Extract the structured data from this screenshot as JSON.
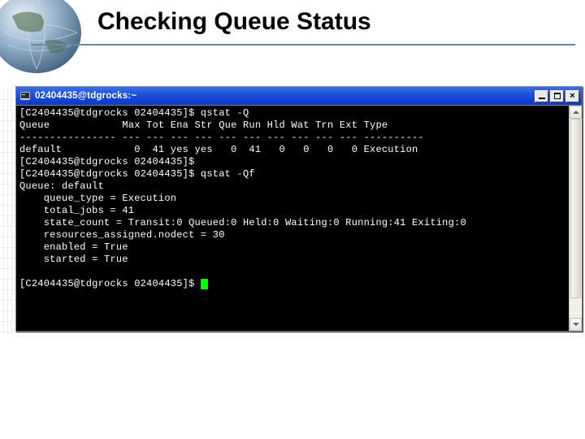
{
  "slide": {
    "title": "Checking Queue Status"
  },
  "window": {
    "title": "02404435@tdgrocks:~",
    "buttons": {
      "minimize": "_",
      "maximize": "□",
      "close": "×"
    }
  },
  "terminal": {
    "lines": [
      "[C2404435@tdgrocks 02404435]$ qstat -Q",
      "Queue            Max Tot Ena Str Que Run Hld Wat Trn Ext Type",
      "---------------- --- --- --- --- --- --- --- --- --- --- ----------",
      "default            0  41 yes yes   0  41   0   0   0   0 Execution",
      "[C2404435@tdgrocks 02404435]$",
      "[C2404435@tdgrocks 02404435]$ qstat -Qf",
      "Queue: default",
      "    queue_type = Execution",
      "    total_jobs = 41",
      "    state_count = Transit:0 Queued:0 Held:0 Waiting:0 Running:41 Exiting:0",
      "    resources_assigned.nodect = 30",
      "    enabled = True",
      "    started = True",
      "",
      "[C2404435@tdgrocks 02404435]$ "
    ]
  },
  "chart_data": {
    "type": "table",
    "title": "qstat -Q",
    "columns": [
      "Queue",
      "Max",
      "Tot",
      "Ena",
      "Str",
      "Que",
      "Run",
      "Hld",
      "Wat",
      "Trn",
      "Ext",
      "Type"
    ],
    "rows": [
      [
        "default",
        0,
        41,
        "yes",
        "yes",
        0,
        41,
        0,
        0,
        0,
        0,
        "Execution"
      ]
    ],
    "detail": {
      "queue": "default",
      "queue_type": "Execution",
      "total_jobs": 41,
      "state_count": {
        "Transit": 0,
        "Queued": 0,
        "Held": 0,
        "Waiting": 0,
        "Running": 41,
        "Exiting": 0
      },
      "resources_assigned.nodect": 30,
      "enabled": true,
      "started": true
    }
  }
}
